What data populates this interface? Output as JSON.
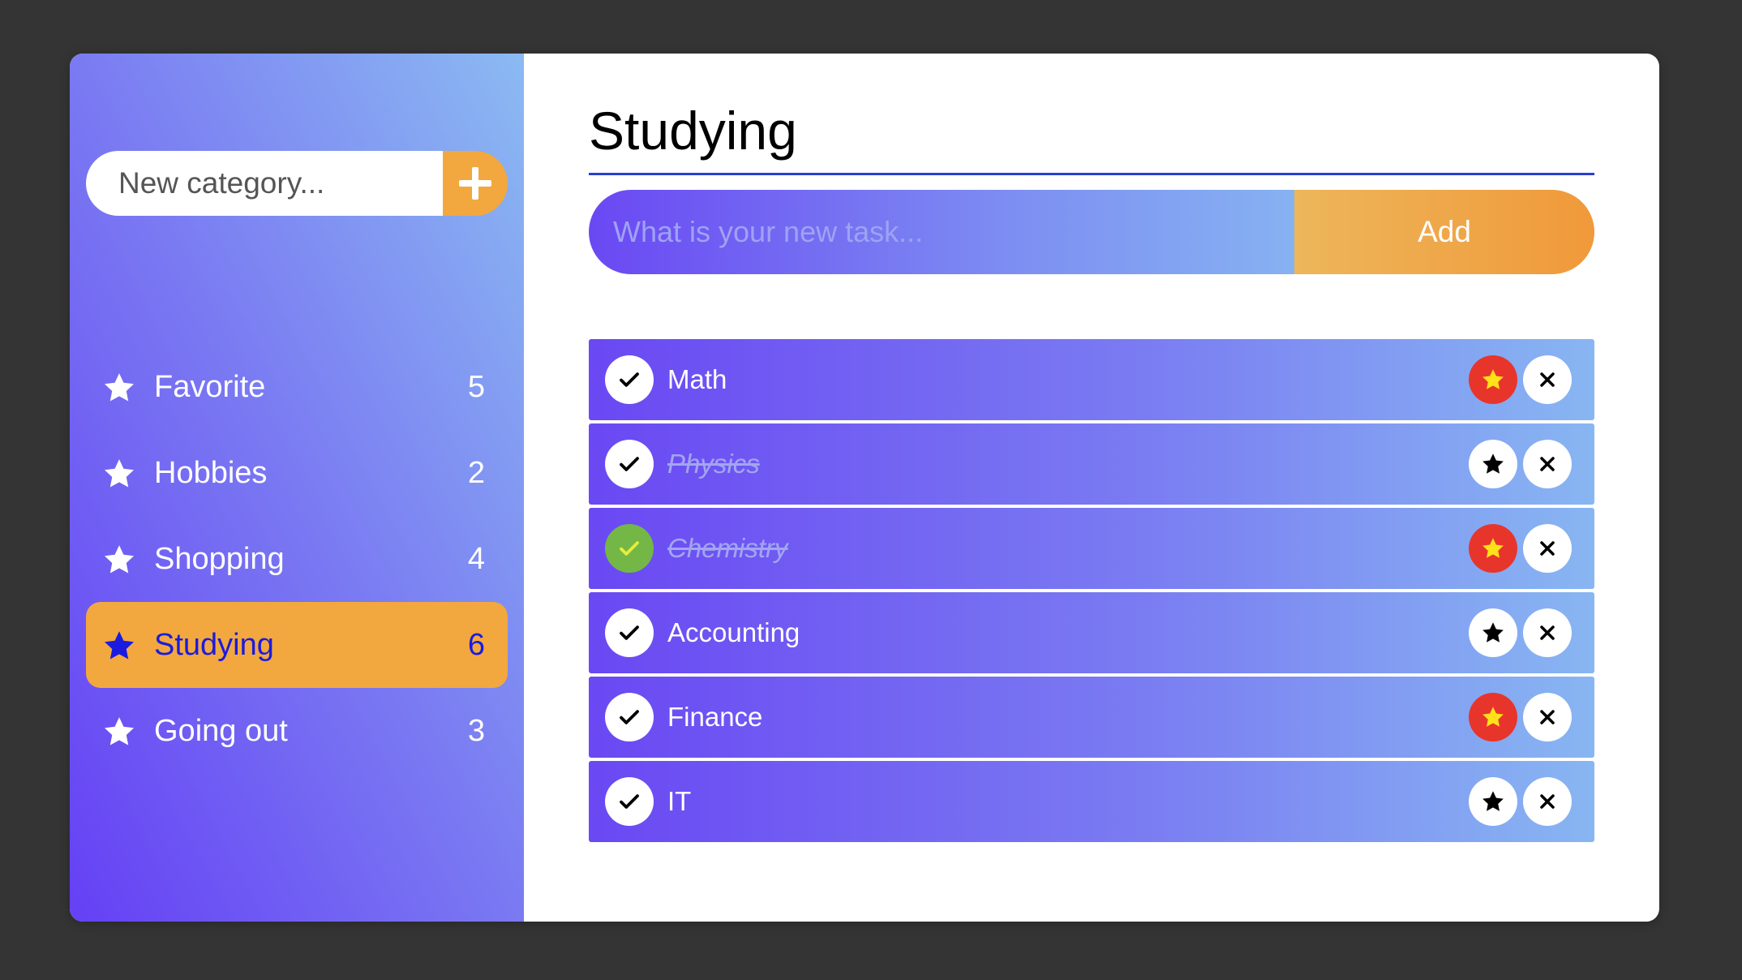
{
  "sidebar": {
    "new_category_placeholder": "New category...",
    "add_icon": "plus-icon",
    "categories": [
      {
        "label": "Favorite",
        "count": "5",
        "icon": "star-icon",
        "active": false
      },
      {
        "label": "Hobbies",
        "count": "2",
        "icon": "star-icon",
        "active": false
      },
      {
        "label": "Shopping",
        "count": "4",
        "icon": "star-icon",
        "active": false
      },
      {
        "label": "Studying",
        "count": "6",
        "icon": "star-icon",
        "active": true
      },
      {
        "label": "Going out",
        "count": "3",
        "icon": "star-icon",
        "active": false
      }
    ]
  },
  "main": {
    "title": "Studying",
    "task_placeholder": "What is your new task...",
    "add_label": "Add",
    "tasks": [
      {
        "label": "Math",
        "completed": false,
        "favorite": true
      },
      {
        "label": "Physics",
        "completed": false,
        "favorite": false,
        "struck": true
      },
      {
        "label": "Chemistry",
        "completed": true,
        "favorite": true,
        "struck": true
      },
      {
        "label": "Accounting",
        "completed": false,
        "favorite": false
      },
      {
        "label": "Finance",
        "completed": false,
        "favorite": true
      },
      {
        "label": "IT",
        "completed": false,
        "favorite": false
      }
    ]
  },
  "colors": {
    "accent_orange": "#f2a83e",
    "active_text": "#1b1bdf",
    "favorite_on": "#e8352b",
    "star_on": "#ffe11a",
    "check_done": "#74b747",
    "check_done_mark": "#e4ee3a"
  }
}
